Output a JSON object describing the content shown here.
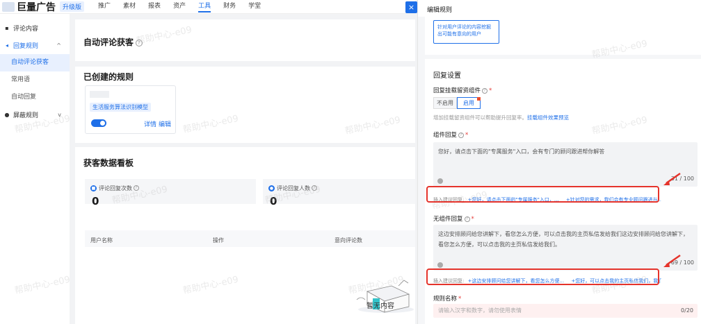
{
  "topbar": {
    "brand": "巨量广告",
    "badge": "升级版",
    "nav": [
      "推广",
      "素材",
      "报表",
      "资产",
      "工具",
      "财务",
      "学堂"
    ],
    "active_nav": "工具"
  },
  "sidebar": {
    "items": [
      {
        "label": "评论内容"
      },
      {
        "label": "回复规则",
        "chevron": "^"
      },
      {
        "label": "屏蔽规则",
        "chevron": "v"
      }
    ],
    "subitems": [
      "自动评论获客",
      "常用语",
      "自动回复"
    ]
  },
  "main": {
    "page_title": "自动评论获客",
    "created_title": "已创建的规则",
    "rule_card": {
      "tag": "生活服务算法识别模型",
      "detail_link": "详情",
      "edit_link": "编辑"
    },
    "board_title": "获客数据看板",
    "stats": [
      {
        "label": "评论回复次数",
        "value": "0"
      },
      {
        "label": "评论回复人数",
        "value": "0"
      }
    ],
    "table_headers": [
      "用户名称",
      "操作",
      "意向评论数"
    ],
    "empty_text": "暂无内容"
  },
  "watermark": "帮助中心-e09",
  "close_icon": "×",
  "drawer": {
    "title": "编辑规则",
    "preview_text": "针对用户评论的内容挖掘出可能有意向的用户",
    "reply_settings_title": "回复设置",
    "component_label": "回复挂载留资组件",
    "seg_off": "不启用",
    "seg_on": "启用",
    "hint_text": "增加挂载留资组件可以帮助提升回复率。",
    "hint_link": "挂载组件效果预览",
    "component_reply_label": "组件回复",
    "component_reply_text": "您好，请点击下面的\"专属服务\"入口，会有专门的顾问跟进帮你解答",
    "component_reply_count": "31 / 100",
    "suggest_prefix": "插入建议回复:",
    "suggest_1a": "+您好，请点击下面的\"专属服务\"入口，...",
    "suggest_1b": "+针对您的需求，我们会有专业顾问跟进与...",
    "no_component_label": "无组件回复",
    "no_component_text": "这边安排顾问给您讲解下，看您怎么方便，可以点击我的主页私信发给我们这边安排顾问给您讲解下，看您怎么方便，可以点击我的主页私信发给我们。",
    "no_component_count": "69 / 100",
    "suggest_2a": "+这边安排顾问给您讲解下，看您怎么方便...",
    "suggest_2b": "+您好，可以点击我的主页私信我们，我们...",
    "rule_name_label": "规则名称",
    "rule_name_placeholder": "请输入汉字和数字，请勿使用表情",
    "rule_name_count": "0/20"
  },
  "colors": {
    "accent": "#1e6fe8",
    "annotation": "#e5332b"
  }
}
